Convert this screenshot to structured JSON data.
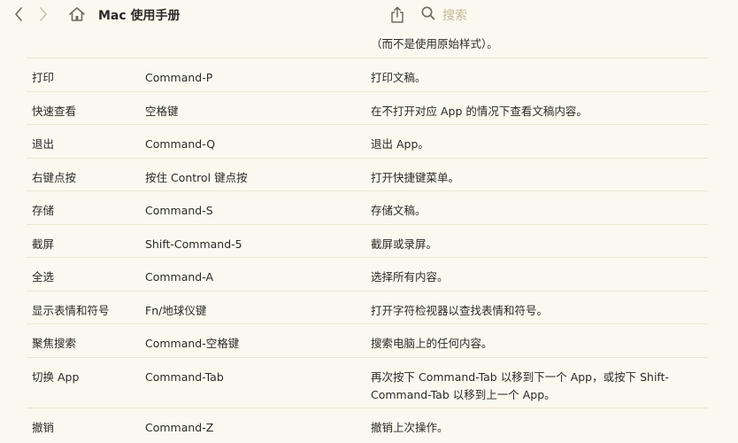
{
  "toolbar": {
    "back_icon": "chevron-left-icon",
    "forward_icon": "chevron-right-icon",
    "home_icon": "home-icon",
    "title": "Mac 使用手册",
    "share_icon": "share-icon",
    "search_icon": "search-icon",
    "search_placeholder": "搜索"
  },
  "continued_text": "（而不是使用原始样式）。",
  "shortcuts": [
    {
      "action": "打印",
      "keys": "Command-P",
      "description": "打印文稿。"
    },
    {
      "action": "快速查看",
      "keys": "空格键",
      "description": "在不打开对应 App 的情况下查看文稿内容。"
    },
    {
      "action": "退出",
      "keys": "Command-Q",
      "description": "退出 App。"
    },
    {
      "action": "右键点按",
      "keys": "按住 Control 键点按",
      "description": "打开快捷键菜单。"
    },
    {
      "action": "存储",
      "keys": "Command-S",
      "description": "存储文稿。"
    },
    {
      "action": "截屏",
      "keys": "Shift-Command-5",
      "description": "截屏或录屏。"
    },
    {
      "action": "全选",
      "keys": "Command-A",
      "description": "选择所有内容。"
    },
    {
      "action": "显示表情和符号",
      "keys": "Fn/地球仪键",
      "description": "打开字符检视器以查找表情和符号。"
    },
    {
      "action": "聚焦搜索",
      "keys": "Command-空格键",
      "description": "搜索电脑上的任何内容。"
    },
    {
      "action": "切换 App",
      "keys": "Command-Tab",
      "description": "再次按下 Command-Tab 以移到下一个 App，或按下 Shift-Command-Tab 以移到上一个 App。"
    },
    {
      "action": "撤销",
      "keys": "Command-Z",
      "description": "撤销上次操作。"
    }
  ],
  "colors": {
    "background": "#fbf8ef",
    "divider": "#ece6d3",
    "icon": "#6f6a5e",
    "search_placeholder": "#c3b898"
  }
}
